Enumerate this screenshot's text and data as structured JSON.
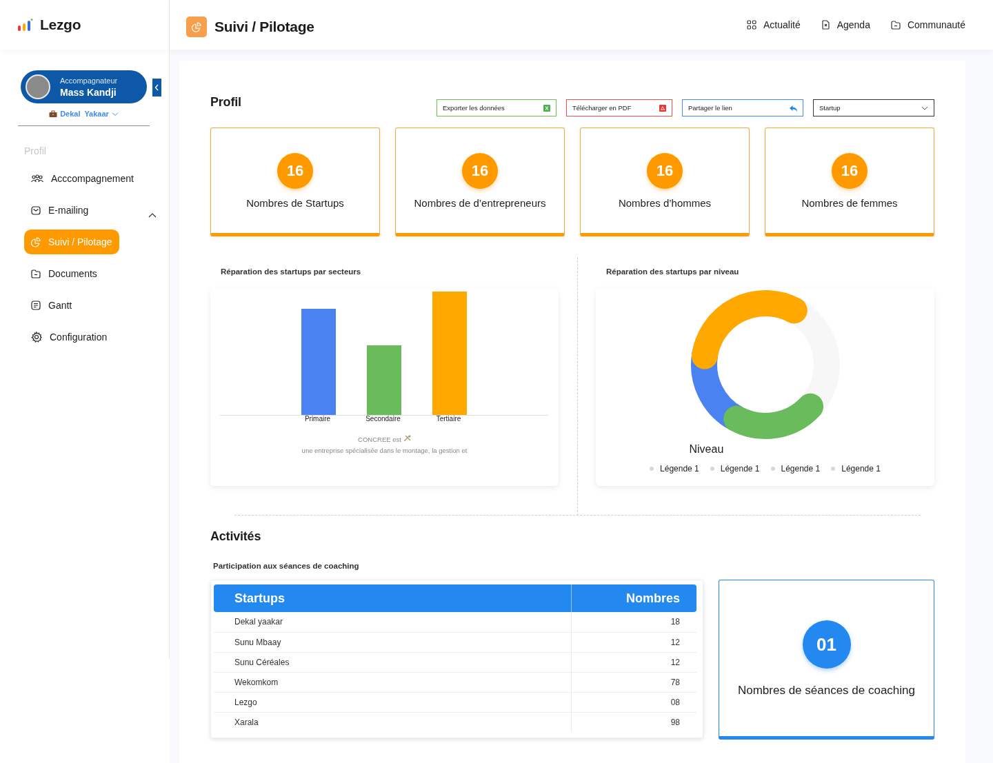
{
  "brand": {
    "name": "Lezgo"
  },
  "profile": {
    "role": "Accompagnateur",
    "name": "Mass Kandji",
    "company": "Dekal  Yakaar"
  },
  "sidebar": {
    "section": "Profil",
    "items": [
      {
        "label": "Acccompagnement",
        "selected": false
      },
      {
        "label": "E-mailing",
        "selected": false,
        "expanded": true
      },
      {
        "label": "Suivi / Pilotage",
        "selected": true
      },
      {
        "label": "Documents",
        "selected": false
      },
      {
        "label": "Gantt",
        "selected": false
      },
      {
        "label": "Configuration",
        "selected": false
      }
    ]
  },
  "header": {
    "title": "Suivi / Pilotage",
    "links": [
      "Actualité",
      "Agenda",
      "Communauté"
    ]
  },
  "profil": {
    "title": "Profil",
    "actions": [
      {
        "label": "Exporter les données",
        "kind": "excel"
      },
      {
        "label": "Télécharger en PDF",
        "kind": "pdf"
      },
      {
        "label": "Partager le lien",
        "kind": "share"
      }
    ],
    "select": {
      "value": "Startup"
    },
    "stats": [
      {
        "value": "16",
        "label": "Nombres de Startups"
      },
      {
        "value": "16",
        "label": "Nombres de d’entrepreneurs"
      },
      {
        "value": "16",
        "label": "Nombres d’hommes"
      },
      {
        "value": "16",
        "label": "Nombres de femmes"
      }
    ]
  },
  "sector_chart": {
    "title": "Réparation des startups  par secteurs",
    "bars": [
      {
        "label": "Primaire",
        "color": "#4a82f2"
      },
      {
        "label": "Secondaire",
        "color": "#69bb5c"
      },
      {
        "label": "Tertiaire",
        "color": "#ffa800"
      }
    ],
    "caption_start": "CONCREE est",
    "caption_end": "une entreprise spécialisée dans le montage, la gestion et"
  },
  "level_chart": {
    "title": "Réparation des startups par niveau",
    "center": "Niveau",
    "segments": [
      {
        "color": "#4a82f2"
      },
      {
        "color": "#69bb5c"
      },
      {
        "color": "#ffa800"
      }
    ],
    "legend": [
      "Légende 1",
      "Légende 1",
      "Légende 1",
      "Légende 1"
    ]
  },
  "activites": {
    "title": "Activités",
    "subtitle": "Participation aux séances de coaching",
    "table": {
      "columns": [
        "Startups",
        "Nombres"
      ],
      "rows": [
        [
          "Dekal yaakar",
          "18"
        ],
        [
          "Sunu Mbaay",
          "12"
        ],
        [
          "Sunu Céréales",
          "12"
        ],
        [
          "Wekomkom",
          "78"
        ],
        [
          "Lezgo",
          "08"
        ],
        [
          "Xarala",
          "98"
        ]
      ]
    },
    "coaching": {
      "value": "01",
      "label": "Nombres de séances de coaching"
    }
  }
}
